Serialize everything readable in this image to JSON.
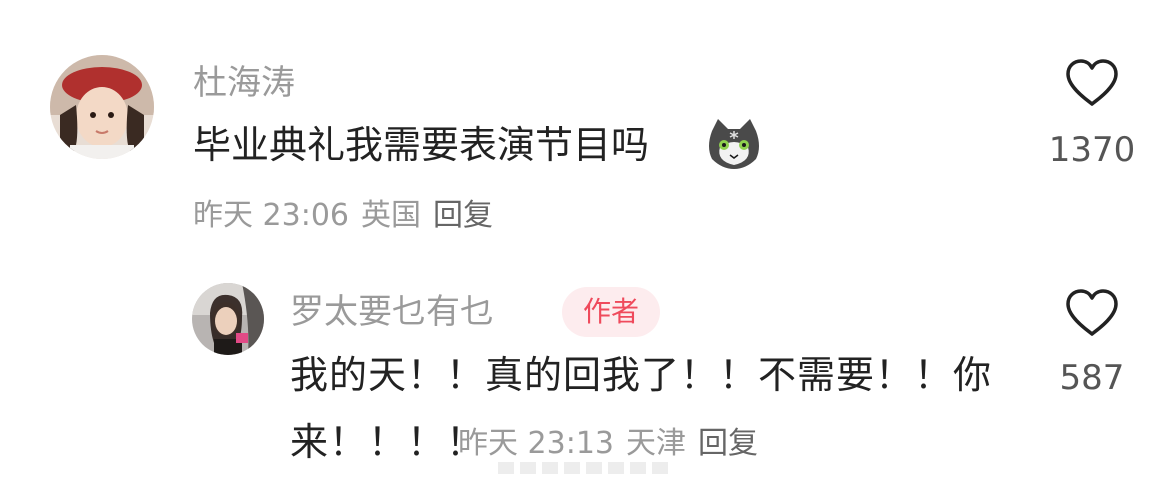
{
  "comment": {
    "username": "杜海涛",
    "text": "毕业典礼我需要表演节目吗",
    "emoji_icon": "cat-emoji-icon",
    "time": "昨天 23:06",
    "location": "英国",
    "reply_label": "回复",
    "like_count": "1370"
  },
  "reply": {
    "username": "罗太要乜有乜",
    "badge": "作者",
    "text_line1": "我的天！！真的回我了！！不需要！！你",
    "text_line2": "来！！！！",
    "time": "昨天 23:13",
    "location": "天津",
    "reply_label": "回复",
    "like_count": "587"
  },
  "colors": {
    "meta_gray": "#9a9a9a",
    "badge_bg": "#fdecee",
    "badge_text": "#ef4a5c"
  }
}
